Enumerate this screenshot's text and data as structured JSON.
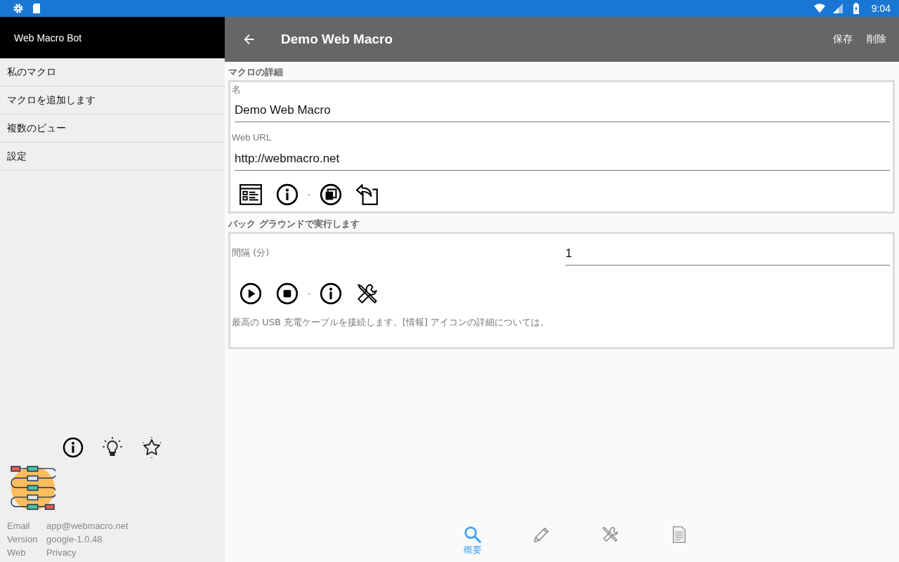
{
  "status_bar": {
    "time": "9:04"
  },
  "drawer": {
    "title": "Web Macro Bot",
    "items": [
      "私のマクロ",
      "マクロを追加します",
      "複数のビュー",
      "設定"
    ],
    "info": [
      {
        "label": "Email",
        "value": "app@webmacro.net"
      },
      {
        "label": "Version",
        "value": "google-1.0.48"
      },
      {
        "label": "Web",
        "value": "Privacy"
      }
    ]
  },
  "toolbar": {
    "title": "Demo Web Macro",
    "actions": [
      "保存",
      "削除"
    ]
  },
  "details": {
    "heading": "マクロの詳細",
    "name_label": "名",
    "name_value": "Demo Web Macro",
    "url_label": "Web URL",
    "url_value": "http://webmacro.net",
    "separator": "-"
  },
  "background": {
    "heading": "バック グラウンドで実行します",
    "interval_label": "間隔 (分)",
    "interval_value": "1",
    "separator": "-",
    "note": "最高の USB 充電ケーブルを接続します。[情報] アイコンの詳細については。"
  },
  "bottom_nav": [
    {
      "kind": "search",
      "label": "概要",
      "selected": true
    },
    {
      "kind": "edit",
      "selected": false
    },
    {
      "kind": "tools",
      "selected": false
    },
    {
      "kind": "document",
      "selected": false
    }
  ]
}
